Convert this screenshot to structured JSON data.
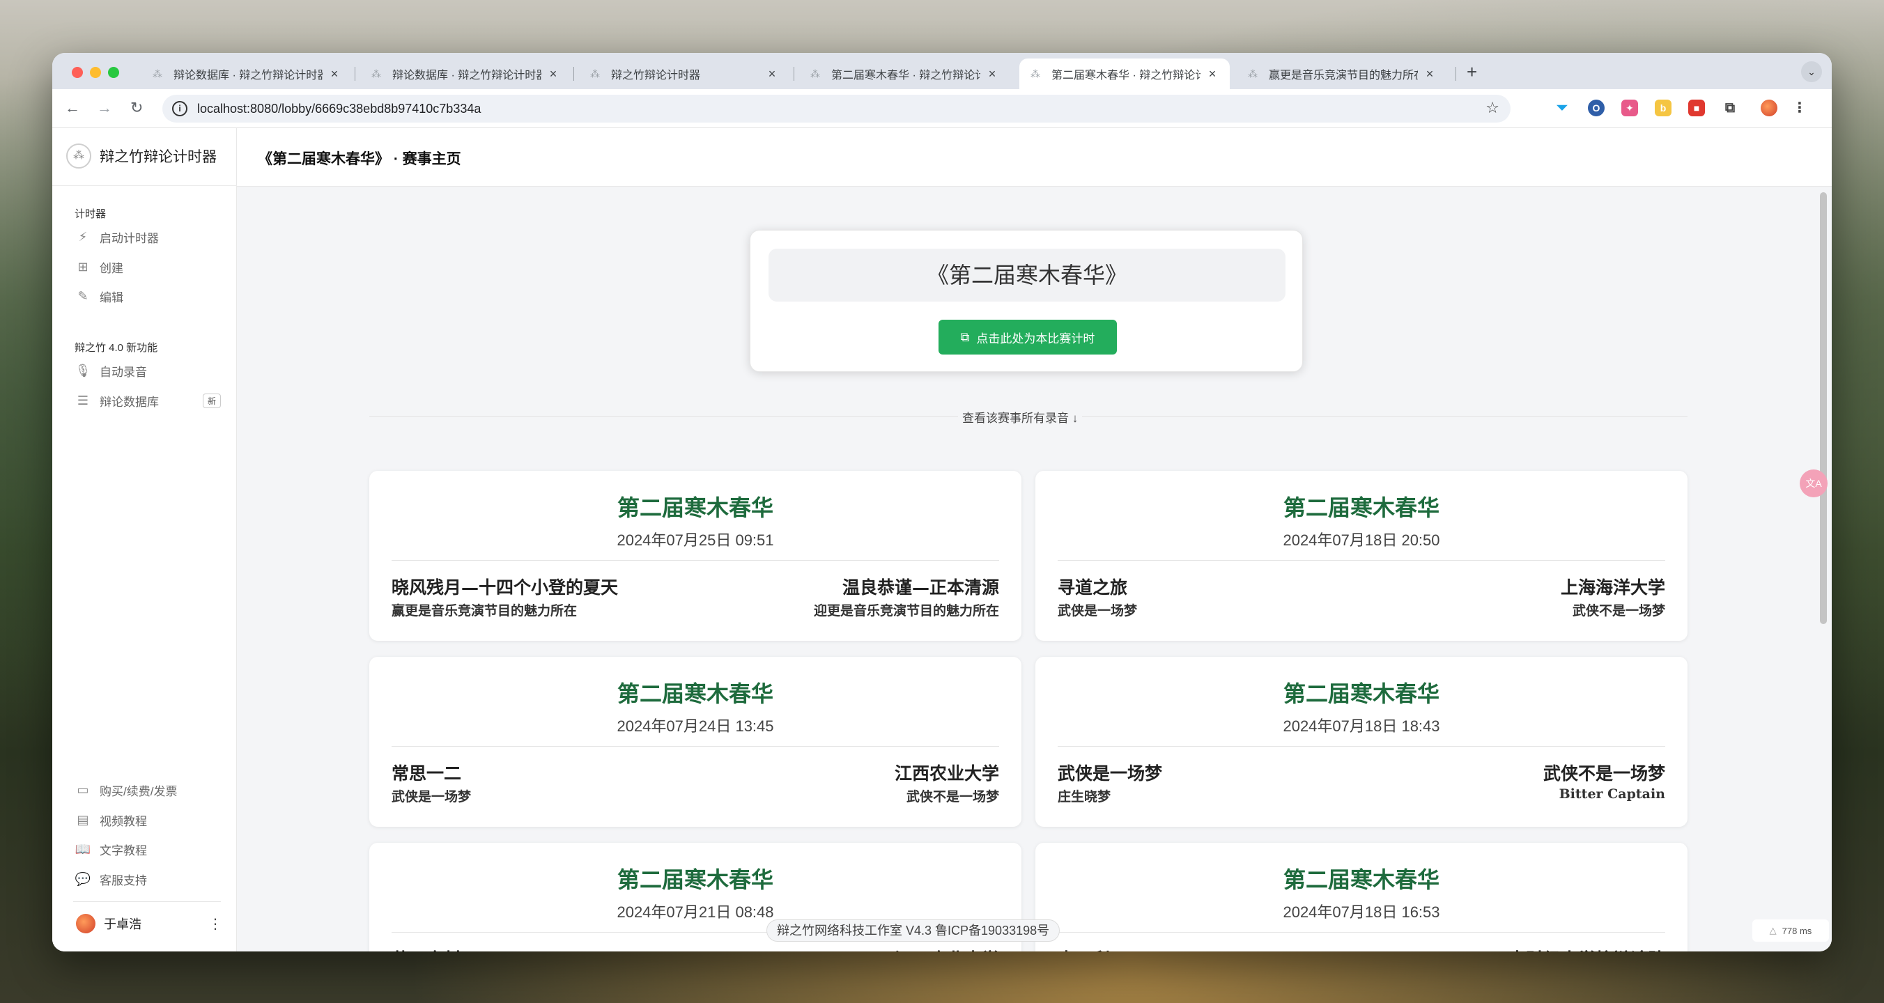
{
  "tabs": [
    {
      "label": "辩论数据库 · 辩之竹辩论计时器",
      "active": false
    },
    {
      "label": "辩论数据库 · 辩之竹辩论计时器",
      "active": false
    },
    {
      "label": "辩之竹辩论计时器",
      "active": false
    },
    {
      "label": "第二届寒木春华 · 辩之竹辩论计时器",
      "active": false
    },
    {
      "label": "第二届寒木春华 · 辩之竹辩论计时器",
      "active": true
    },
    {
      "label": "赢更是音乐竞演节目的魅力所在",
      "active": false
    }
  ],
  "browser": {
    "url": "localhost:8080/lobby/6669c38ebd8b97410c7b334a",
    "new_tab": "+",
    "tab_menu": "⌄"
  },
  "icons": {
    "back": "arrow-left-icon",
    "forward": "arrow-right-icon",
    "reload": "reload-icon",
    "star": "star-icon"
  },
  "sidebar": {
    "brand": "辩之竹辩论计时器",
    "group1": "计时器",
    "items1": [
      {
        "label": "启动计时器",
        "icon": "⚡"
      },
      {
        "label": "创建",
        "icon": "⊞"
      },
      {
        "label": "编辑",
        "icon": "✎"
      }
    ],
    "group2": "辩之竹 4.0 新功能",
    "items2": [
      {
        "label": "自动录音",
        "icon": "🎙"
      },
      {
        "label": "辩论数据库",
        "icon": "☰",
        "badge": "新"
      }
    ],
    "bottom_items": [
      {
        "label": "购买/续费/发票",
        "icon": "▭"
      },
      {
        "label": "视频教程",
        "icon": "▤"
      },
      {
        "label": "文字教程",
        "icon": "📖"
      },
      {
        "label": "客服支持",
        "icon": "💬"
      }
    ],
    "user_name": "于卓浩",
    "user_more": "⋮"
  },
  "header": {
    "title": "《第二届寒木春华》 · 赛事主页"
  },
  "hero": {
    "title": "《第二届寒木春华》",
    "button": "点击此处为本比赛计时"
  },
  "recordings_label": "查看该赛事所有录音 ↓",
  "matches": [
    {
      "title": "第二届寒木春华",
      "date": "2024年07月25日 09:51",
      "team_a": "晓风残月—十四个小登的夏天",
      "team_a_sub": "赢更是音乐竞演节目的魅力所在",
      "team_b": "温良恭谨—正本清源",
      "team_b_sub": "迎更是音乐竞演节目的魅力所在"
    },
    {
      "title": "第二届寒木春华",
      "date": "2024年07月18日 20:50",
      "team_a": "寻道之旅",
      "team_a_sub": "武侠是一场梦",
      "team_b": "上海海洋大学",
      "team_b_sub": "武侠不是一场梦"
    },
    {
      "title": "第二届寒木春华",
      "date": "2024年07月24日 13:45",
      "team_a": "常思一二",
      "team_a_sub": "武侠是一场梦",
      "team_b": "江西农业大学",
      "team_b_sub": "武侠不是一场梦"
    },
    {
      "title": "第二届寒木春华",
      "date": "2024年07月18日 18:43",
      "team_a": "武侠是一场梦",
      "team_a_sub": "庄生晓梦",
      "team_b": "武侠不是一场梦",
      "team_b_sub": "Bitter Captain"
    },
    {
      "title": "第二届寒木春华",
      "date": "2024年07月21日 08:48",
      "team_a": "草二春材",
      "team_a_sub": "",
      "team_b": "江西农业大学",
      "team_b_sub": ""
    },
    {
      "title": "第二届寒木春华",
      "date": "2024年07月18日 16:53",
      "team_a": "李三利瓦",
      "team_a_sub": "",
      "team_b": "西南财经大学校辩论队",
      "team_b_sub": ""
    }
  ],
  "footer": "辩之竹网络科技工作室   V4.3   鲁ICP备19033198号",
  "perf_label": "778 ms",
  "float_button": "文A"
}
